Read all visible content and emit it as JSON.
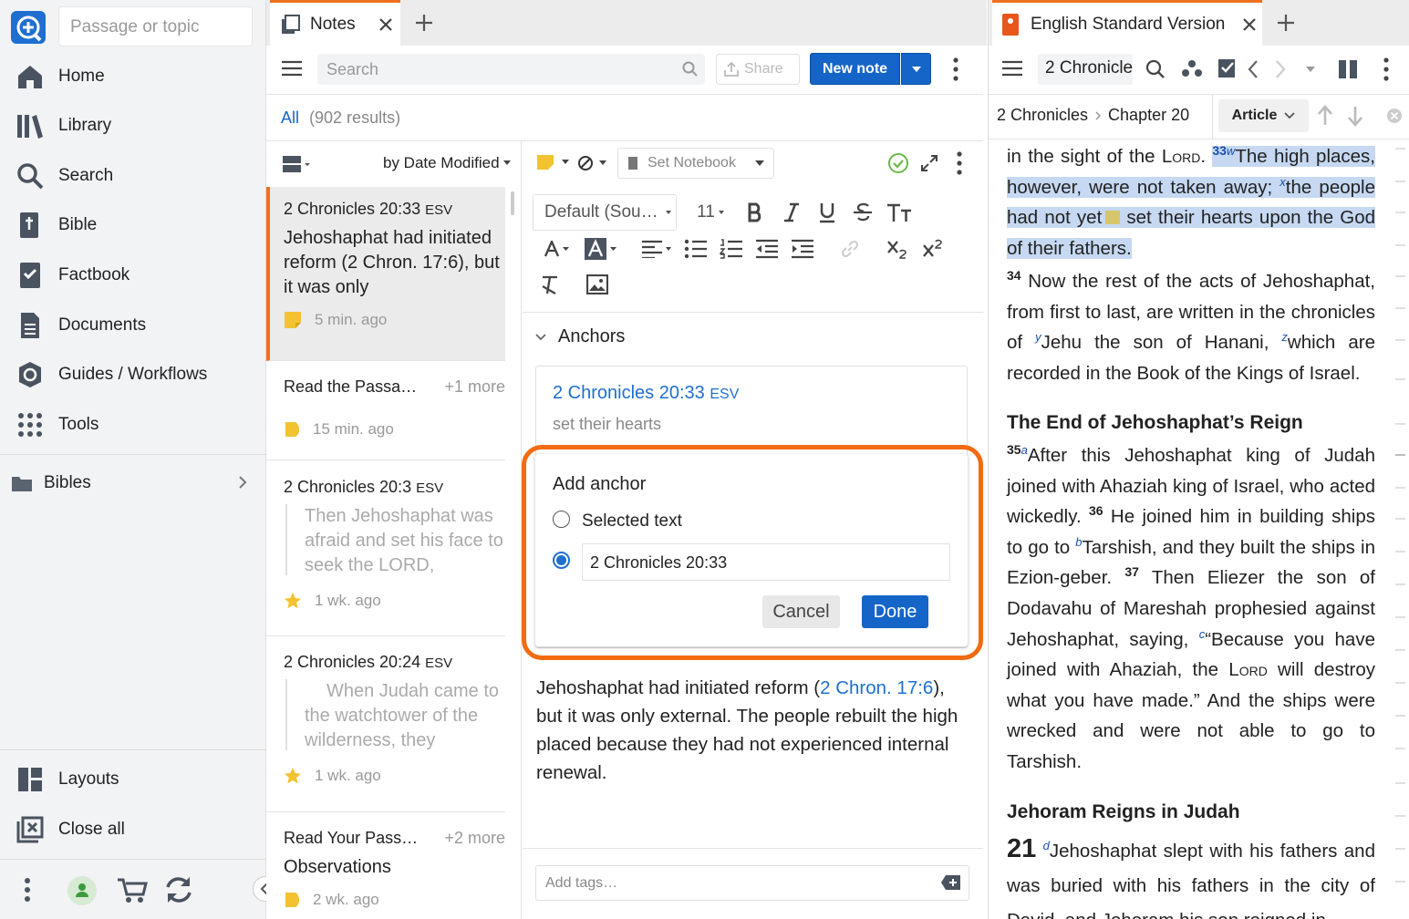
{
  "sidebar": {
    "passage_placeholder": "Passage or topic",
    "items": [
      {
        "label": "Home"
      },
      {
        "label": "Library"
      },
      {
        "label": "Search"
      },
      {
        "label": "Bible"
      },
      {
        "label": "Factbook"
      },
      {
        "label": "Documents"
      },
      {
        "label": "Guides / Workflows"
      },
      {
        "label": "Tools"
      }
    ],
    "bibles_label": "Bibles",
    "layouts_label": "Layouts",
    "close_all_label": "Close all"
  },
  "notes_panel": {
    "tab_label": "Notes",
    "search_placeholder": "Search",
    "share_label": "Share",
    "new_note_label": "New note",
    "filter_all": "All",
    "results": "(902 results)",
    "sort_label": "by Date Modified",
    "notes": [
      {
        "ref": "2 Chronicles 20:33",
        "version": "ESV",
        "body": "Jehoshaphat had initiated reform (2 Chron. 17:6), but it was only",
        "time": "5 min. ago",
        "marker": "note"
      },
      {
        "ref": "Read the Passa…",
        "more": "+1 more",
        "time": "15 min. ago",
        "marker": "highlight"
      },
      {
        "ref": "2 Chronicles 20:3",
        "version": "ESV",
        "quote": "Then Jehoshaphat was afraid and set his face to seek the LORD,",
        "time": "1 wk. ago",
        "marker": "star"
      },
      {
        "ref": "2 Chronicles 20:24",
        "version": "ESV",
        "quote": "When Judah came to the watchtower of the wilderness, they",
        "time": "1 wk. ago",
        "marker": "star"
      },
      {
        "ref": "Read Your Pass…",
        "more": "+2 more",
        "sub": "Observations",
        "time": "2 wk. ago",
        "marker": "highlight"
      }
    ]
  },
  "editor": {
    "notebook_label": "Set Notebook",
    "font_family": "Default (Sou…",
    "font_size": "11",
    "anchors_label": "Anchors",
    "anchor": {
      "ref": "2 Chronicles 20:33",
      "version": "ESV",
      "text": "set their hearts"
    },
    "add_anchor": {
      "title": "Add anchor",
      "option_selected_text": "Selected text",
      "reference_value": "2 Chronicles 20:33",
      "cancel_label": "Cancel",
      "done_label": "Done"
    },
    "note_body_pre": "Jehoshaphat had initiated reform (",
    "note_body_link": "2 Chron. 17:6",
    "note_body_post": "), but it was only external. The people rebuilt the high placed because they had not experienced internal renewal.",
    "tags_placeholder": "Add tags…"
  },
  "bible_panel": {
    "tab_label": "English Standard Version",
    "reference_input": "2 Chronicle",
    "breadcrumb_book": "2 Chronicles",
    "breadcrumb_chapter": "Chapter 20",
    "view_mode": "Article",
    "v32_end_pre": "in the sight of the ",
    "lord": "Lord",
    "v32_end_post": ".",
    "v33_num": "33",
    "v33_fn_w": "w",
    "v33_a": "The high places, however, were not taken away; ",
    "v33_fn_x": "x",
    "v33_b": "the people had not yet",
    "v33_c": " set their hearts upon the God of their fathers.",
    "v34_num": "34",
    "v34_a": "Now the rest of the acts of Jehoshaphat, from first to last, are written in the chronicles of ",
    "v34_fn_y": "y",
    "v34_b": "Jehu the son of Hanani, ",
    "v34_fn_z": "z",
    "v34_c": "which are recorded in the Book of the Kings of Israel.",
    "heading1": "The End of Jehoshaphat’s Reign",
    "v35_num": "35",
    "v35_fn": "a",
    "v35": "After this Jehoshaphat king of Judah joined with Ahaziah king of Israel, who acted wickedly.",
    "v36_num": "36",
    "v36_a": "He joined him in building ships to go to ",
    "v36_fn": "b",
    "v36_b": "Tarshish, and they built the ships in Ezion-geber.",
    "v37_num": "37",
    "v37_a": "Then Eliezer the son of Dodavahu of Mareshah prophesied against Jehoshaphat, saying, ",
    "v37_fn": "c",
    "v37_b": "“Because you have joined with Ahaziah, the ",
    "v37_c": " will destroy what you have made.” And the ships were wrecked and were not able to go to Tarshish.",
    "heading2": "Jehoram Reigns in Judah",
    "ch21_num": "21",
    "ch21_fn": "d",
    "ch21_v1": "Jehoshaphat slept with his fathers and was buried with his fathers in the city of David, and Jehoram his son reigned in"
  }
}
